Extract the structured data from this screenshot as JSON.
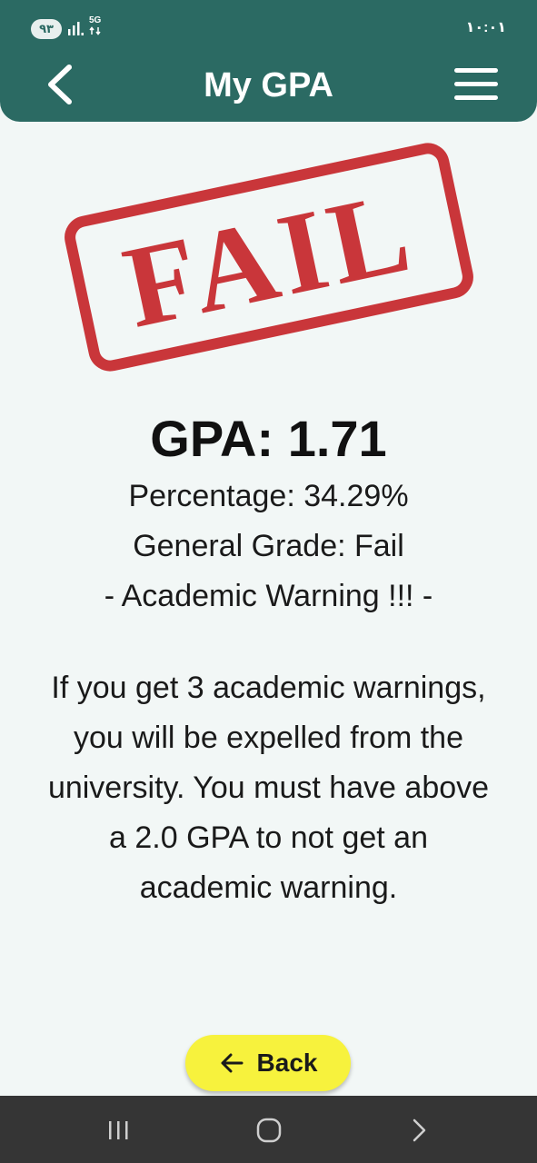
{
  "status_bar": {
    "battery": "٩٣",
    "network": "5G",
    "time": "١٠:٠١"
  },
  "header": {
    "title": "My GPA",
    "back_icon": "chevron-left-icon",
    "menu_icon": "hamburger-menu-icon"
  },
  "stamp": {
    "text": "FAIL",
    "color": "#c9363a"
  },
  "result": {
    "gpa": "GPA: 1.71",
    "percentage": "Percentage: 34.29%",
    "grade": "General Grade: Fail",
    "warning": "- Academic Warning !!! -",
    "explanation": "If you get 3 academic warnings, you will be expelled from the university. You must have above a 2.0 GPA to not get an academic warning."
  },
  "back_button": {
    "label": "Back",
    "icon": "arrow-left-icon",
    "color": "#f7f23d"
  },
  "colors": {
    "header": "#2b6a63",
    "background": "#f2f7f6",
    "navbar": "#353535"
  },
  "nav_bar": {
    "recents_icon": "recents-icon",
    "home_icon": "home-icon",
    "back_icon": "nav-back-icon"
  }
}
